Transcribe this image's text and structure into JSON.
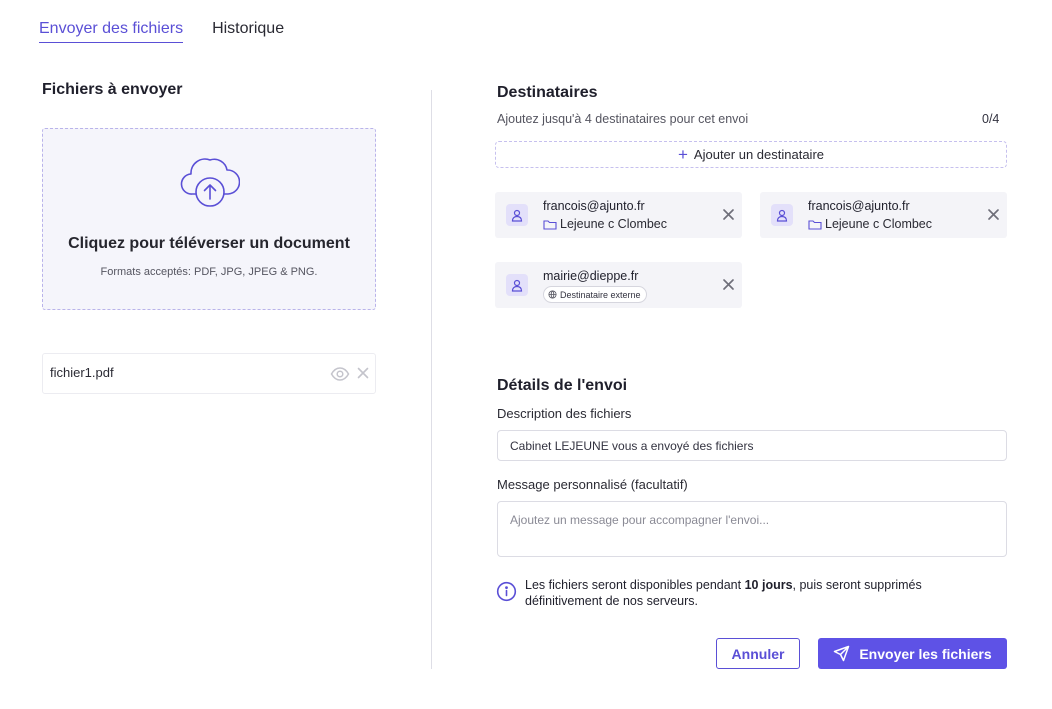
{
  "tabs": [
    {
      "label": "Envoyer des fichiers",
      "active": true
    },
    {
      "label": "Historique",
      "active": false
    }
  ],
  "files": {
    "title": "Fichiers à envoyer",
    "dropzone_title": "Cliquez pour téléverser un document",
    "dropzone_formats": "Formats acceptés: PDF, JPG, JPEG & PNG.",
    "list": [
      {
        "name": "fichier1.pdf"
      }
    ]
  },
  "recipients": {
    "title": "Destinataires",
    "subtitle": "Ajoutez jusqu'à 4 destinataires pour cet envoi",
    "count": "0/4",
    "add_label": "Ajouter un destinataire",
    "items": [
      {
        "email": "francois@ajunto.fr",
        "org": "Lejeune c Clombec"
      },
      {
        "email": "francois@ajunto.fr",
        "org": "Lejeune c Clombec"
      },
      {
        "email": "mairie@dieppe.fr",
        "badge": "Destinataire externe"
      }
    ]
  },
  "details": {
    "title": "Détails de l'envoi",
    "description_label": "Description des fichiers",
    "description_value": "Cabinet LEJEUNE vous a envoyé des fichiers",
    "message_label": "Message personnalisé (facultatif)",
    "message_placeholder": "Ajoutez un message pour accompagner l'envoi...",
    "info_before": "Les fichiers seront disponibles pendant ",
    "info_bold": "10 jours",
    "info_after": ", puis seront supprimés définitivement de nos serveurs."
  },
  "actions": {
    "cancel": "Annuler",
    "send": "Envoyer les fichiers"
  },
  "colors": {
    "accent": "#5a4fd6",
    "accent_button": "#5e52e6",
    "card_bg": "#f4f4f8"
  }
}
